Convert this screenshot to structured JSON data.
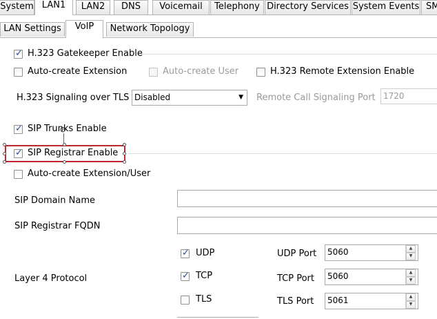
{
  "tabs_top": [
    "System",
    "LAN1",
    "LAN2",
    "DNS",
    "Voicemail",
    "Telephony",
    "Directory Services",
    "System Events",
    "SM"
  ],
  "tabs_sub": [
    "LAN Settings",
    "VoIP",
    "Network Topology"
  ],
  "h323": {
    "gatekeeper_label": "H.323 Gatekeeper Enable",
    "auto_ext_label": "Auto-create Extension",
    "auto_user_label": "Auto-create User",
    "remote_ext_label": "H.323 Remote Extension Enable",
    "tls_label": "H.323 Signaling over TLS",
    "tls_value": "Disabled",
    "remote_port_label": "Remote Call Signaling Port",
    "remote_port_value": "1720"
  },
  "sip": {
    "trunks_label": "SIP Trunks Enable",
    "registrar_label": "SIP Registrar Enable",
    "auto_ext_user_label": "Auto-create Extension/User",
    "domain_label": "SIP Domain Name",
    "domain_value": "",
    "fqdn_label": "SIP Registrar FQDN",
    "fqdn_value": "",
    "layer4_label": "Layer 4 Protocol",
    "udp_label": "UDP",
    "tcp_label": "TCP",
    "tls_label": "TLS",
    "udp_port_label": "UDP Port",
    "udp_port_value": "5060",
    "tcp_port_label": "TCP Port",
    "tcp_port_value": "5060",
    "tls_port_label": "TLS Port",
    "tls_port_value": "5061"
  },
  "colors": {
    "selection_box": "#c0262d",
    "check": "#2a4f9a"
  },
  "icons": {
    "dropdown": "caret-down-icon",
    "spin_up": "spin-up-icon",
    "spin_down": "spin-down-icon"
  }
}
